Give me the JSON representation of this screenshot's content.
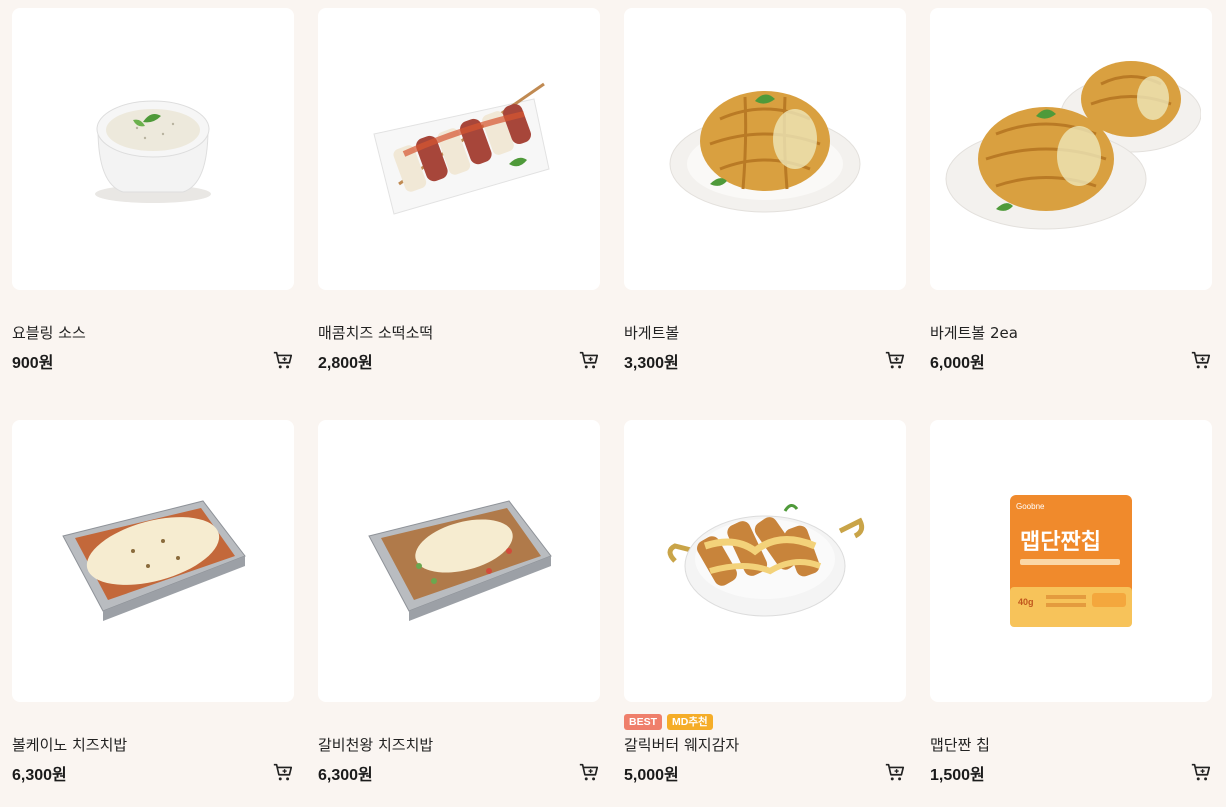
{
  "products": [
    {
      "name": "요블링 소스",
      "price": "900원",
      "image": "white-sauce-cup"
    },
    {
      "name": "매콤치즈 소떡소떡",
      "price": "2,800원",
      "image": "sausage-rice-cake-skewer"
    },
    {
      "name": "바게트볼",
      "price": "3,300원",
      "image": "baguette-ball"
    },
    {
      "name": "바게트볼 2ea",
      "price": "6,000원",
      "image": "two-baguette-balls"
    },
    {
      "name": "볼케이노 치즈치밥",
      "price": "6,300원",
      "image": "cheese-rice-tray"
    },
    {
      "name": "갈비천왕 치즈치밥",
      "price": "6,300원",
      "image": "galbi-cheese-rice-tray"
    },
    {
      "name": "갈릭버터 웨지감자",
      "price": "5,000원",
      "image": "wedge-potato-pan",
      "badges": [
        {
          "label": "BEST",
          "color": "#ef7f6b"
        },
        {
          "label": "MD추천",
          "color": "#f5ad28"
        }
      ]
    },
    {
      "name": "맵단짠 칩",
      "price": "1,500원",
      "image": "chip-bag",
      "package": {
        "brand": "Goobne",
        "title": "맵단짠칩",
        "weight": "40g"
      }
    }
  ],
  "icons": {
    "cart": "cart-icon"
  },
  "colors": {
    "background": "#faf5f1",
    "card": "#ffffff",
    "best": "#ef7f6b",
    "md": "#f5ad28"
  }
}
